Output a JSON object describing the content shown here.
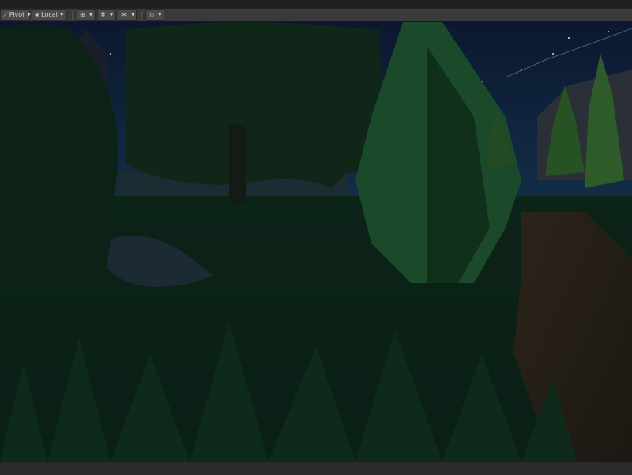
{
  "toolbar": {
    "pivot_label": "Pivot",
    "local_label": "Local",
    "pivot_icon": "pivot-icon",
    "local_icon": "cube-icon",
    "snap_icon": "grid-snap-icon",
    "grid_icon": "grid-icon",
    "increment_icon": "increment-snap-icon",
    "gizmo_icon": "gizmo-icon"
  },
  "scene": {
    "sky_color": "#0e1a2e",
    "grass_color": "#0f2a1c",
    "path_color": "#2a2218",
    "water_color": "#1a2a33"
  }
}
